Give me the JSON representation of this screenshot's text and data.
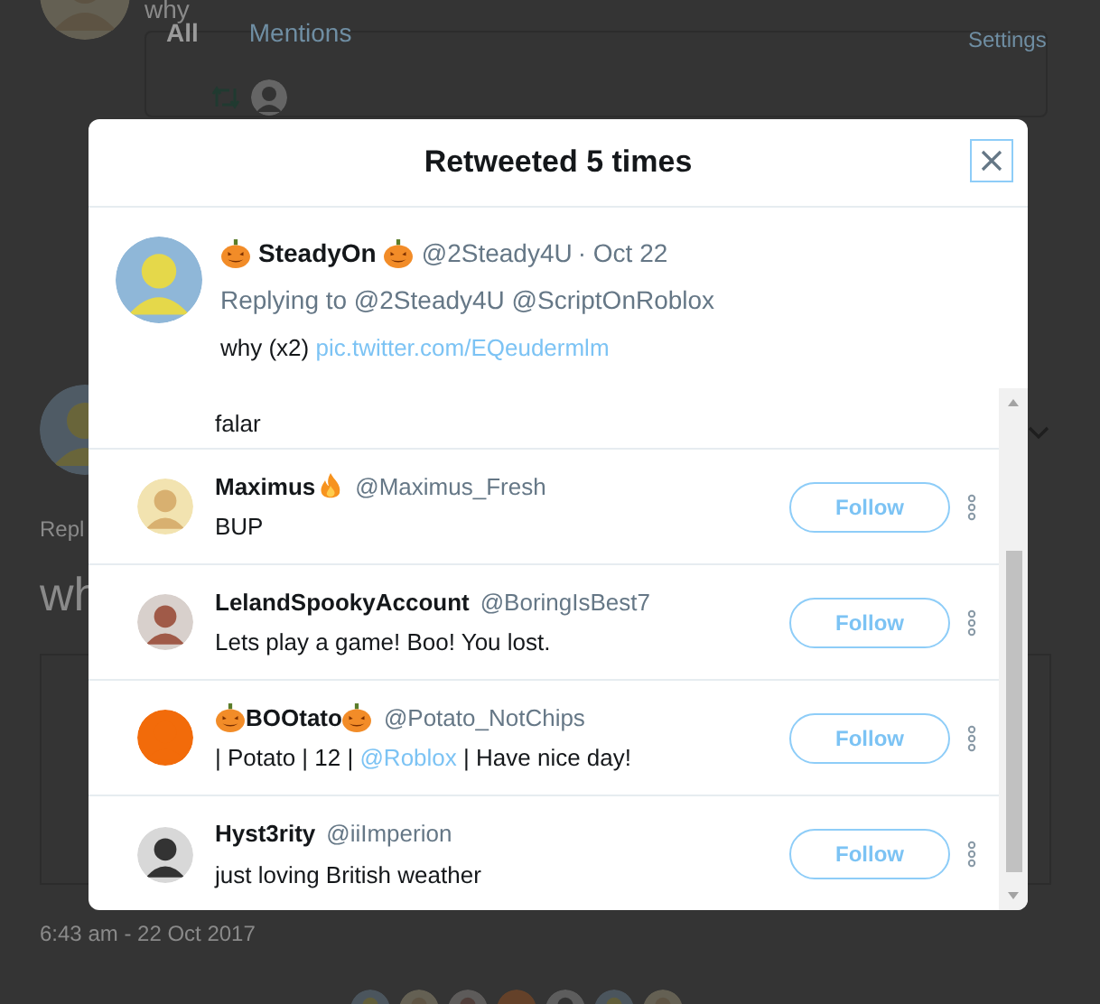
{
  "background": {
    "tweet_text": "why",
    "tabs": [
      {
        "label": "All",
        "selected": true
      },
      {
        "label": "Mentions",
        "selected": false
      }
    ],
    "settings": "Settings",
    "reply_label": "Repl",
    "big_text": "wh",
    "timestamp": "6:43 am - 22 Oct 2017"
  },
  "dialog": {
    "title": "Retweeted 5 times",
    "tweet": {
      "icons_before": [
        {
          "kind": "pumpkin"
        }
      ],
      "name": "SteadyOn",
      "icons_after": [
        {
          "kind": "pumpkin"
        }
      ],
      "handle": "@2Steady4U",
      "time": "· Oct 22",
      "replying": "Replying to @2Steady4U @ScriptOnRoblox",
      "parts": [
        {
          "kind": "text",
          "text": "why (x2) "
        },
        {
          "kind": "link",
          "text": "pic.twitter.com/EQeudermlm"
        }
      ],
      "extra": "falar"
    },
    "users": [
      {
        "name": "Maximus",
        "icons_after": [
          {
            "kind": "flame"
          }
        ],
        "handle": "@Maximus_Fresh",
        "bio": [
          {
            "kind": "text",
            "text": "BUP"
          }
        ],
        "button": "Follow"
      },
      {
        "name": "LelandSpookyAccount",
        "handle": "@BoringIsBest7",
        "bio": [
          {
            "kind": "text",
            "text": "Lets play a game! Boo! You lost."
          }
        ],
        "button": "Follow"
      },
      {
        "icons_before": [
          {
            "kind": "pumpkin"
          }
        ],
        "name": "BOOtato",
        "icons_after": [
          {
            "kind": "pumpkin"
          }
        ],
        "handle": "@Potato_NotChips",
        "bio": [
          {
            "kind": "text",
            "text": "| Potato | 12 | "
          },
          {
            "kind": "link",
            "text": "@Roblox"
          },
          {
            "kind": "text",
            "text": " | Have nice day!"
          }
        ],
        "button": "Follow"
      },
      {
        "name": "Hyst3rity",
        "handle": "@iiImperion",
        "bio": [
          {
            "kind": "text",
            "text": "just loving British weather"
          }
        ],
        "button": "Follow"
      }
    ]
  }
}
